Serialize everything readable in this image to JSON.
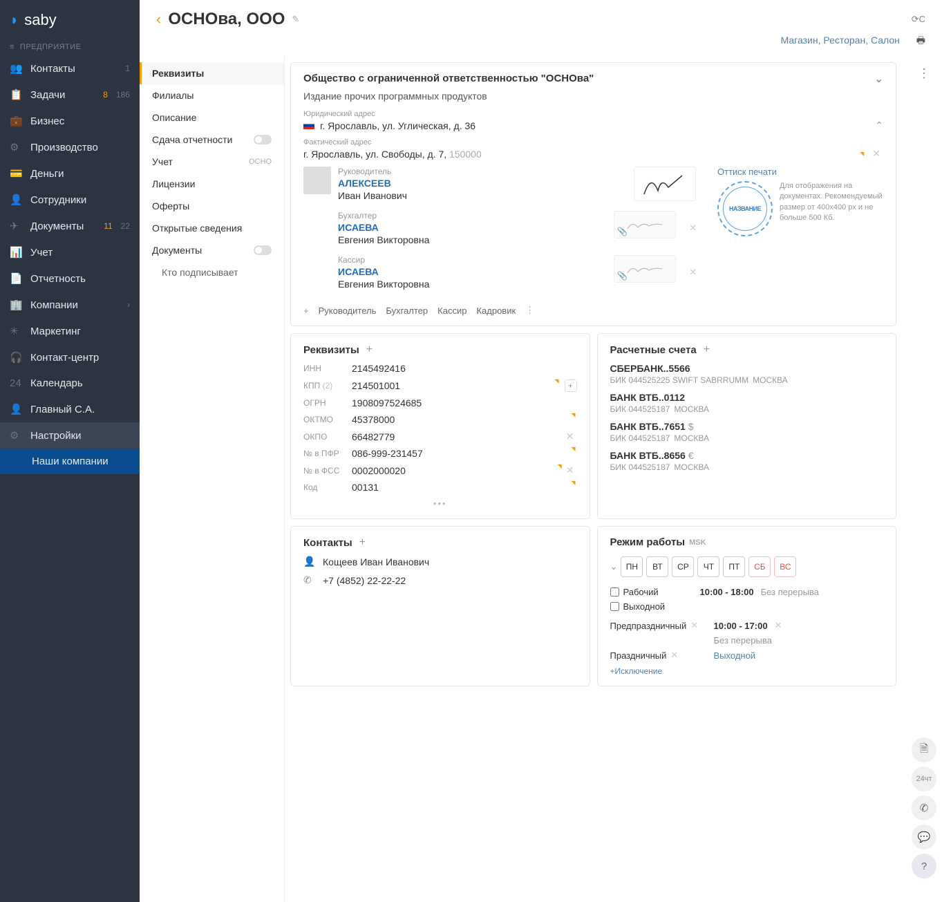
{
  "logo": "saby",
  "nav_section": "ПРЕДПРИЯТИЕ",
  "nav": [
    {
      "icon": "👥",
      "label": "Контакты",
      "b2": "1"
    },
    {
      "icon": "📋",
      "label": "Задачи",
      "b1": "8",
      "b2": "186"
    },
    {
      "icon": "💼",
      "label": "Бизнес"
    },
    {
      "icon": "⚙",
      "label": "Производство"
    },
    {
      "icon": "💳",
      "label": "Деньги"
    },
    {
      "icon": "👤",
      "label": "Сотрудники"
    },
    {
      "icon": "✈",
      "label": "Документы",
      "b1": "11",
      "b2": "22"
    },
    {
      "icon": "📊",
      "label": "Учет"
    },
    {
      "icon": "📄",
      "label": "Отчетность"
    },
    {
      "icon": "🏢",
      "label": "Компании",
      "arrow": "›"
    },
    {
      "icon": "✳",
      "label": "Маркетинг"
    },
    {
      "icon": "🎧",
      "label": "Контакт-центр"
    },
    {
      "icon": "24",
      "label": "Календарь"
    },
    {
      "icon": "👤",
      "label": "Главный С.А."
    },
    {
      "icon": "⚙",
      "label": "Настройки",
      "active": true
    }
  ],
  "nav_sub": "Наши компании",
  "header": {
    "title": "ОСНОва, ООО",
    "type_link": "Магазин, Ресторан, Салон",
    "sync": "⟳С"
  },
  "tabs": [
    {
      "label": "Реквизиты",
      "active": true
    },
    {
      "label": "Филиалы"
    },
    {
      "label": "Описание"
    },
    {
      "label": "Сдача отчетности",
      "toggle": true
    },
    {
      "label": "Учет",
      "tag": "ОСНО"
    },
    {
      "label": "Лицензии"
    },
    {
      "label": "Оферты"
    },
    {
      "label": "Открытые сведения"
    },
    {
      "label": "Документы",
      "toggle": true
    },
    {
      "label": "Кто подписывает",
      "sub": true
    }
  ],
  "org": {
    "full": "Общество с ограниченной ответственностью \"ОСНОва\"",
    "desc": "Издание прочих программных продуктов",
    "addr_legal_lbl": "Юридический адрес",
    "addr_legal": "г. Ярославль, ул. Углическая, д. 36",
    "addr_fact_lbl": "Фактический адрес",
    "addr_fact": "г. Ярославль, ул. Свободы, д. 7, ",
    "addr_fact_post": "150000"
  },
  "people": [
    {
      "role": "Руководитель",
      "surname": "АЛЕКСЕЕВ",
      "name": "Иван Иванович",
      "avatar": true,
      "big": true
    },
    {
      "role": "Бухгалтер",
      "surname": "ИСАЕВА",
      "name": "Евгения Викторовна",
      "small": true
    },
    {
      "role": "Кассир",
      "surname": "ИСАЕВА",
      "name": "Евгения Викторовна",
      "small": true
    }
  ],
  "stamp": {
    "label": "Оттиск печати",
    "text": "НАЗВАНИЕ",
    "hint": "Для отображения на документах. Рекомендуемый размер от 400x400 px и не больше 500 Кб."
  },
  "add_roles": [
    "Руководитель",
    "Бухгалтер",
    "Кассир",
    "Кадровик"
  ],
  "req": {
    "title": "Реквизиты",
    "rows": [
      {
        "lbl": "ИНН",
        "val": "2145492416"
      },
      {
        "lbl": "КПП",
        "sub": "(2)",
        "val": "214501001",
        "mark": true,
        "add": true
      },
      {
        "lbl": "ОГРН",
        "val": "1908097524685"
      },
      {
        "lbl": "ОКТМО",
        "val": "45378000",
        "mark": true
      },
      {
        "lbl": "ОКПО",
        "val": "66482779",
        "x": true
      },
      {
        "lbl": "№ в ПФР",
        "val": "086-999-231457",
        "mark": true
      },
      {
        "lbl": "№ в ФСС",
        "val": "0002000020",
        "mark": true,
        "x": true
      },
      {
        "lbl": "Код",
        "val": "00131",
        "mark": true
      }
    ]
  },
  "banks": {
    "title": "Расчетные счета",
    "items": [
      {
        "name": "СБЕРБАНК..5566",
        "info": "БИК 044525225 SWIFT SABRRUMM",
        "city": "МОСКВА"
      },
      {
        "name": "БАНК ВТБ..0112",
        "info": "БИК 044525187",
        "city": "МОСКВА"
      },
      {
        "name": "БАНК ВТБ..7651",
        "cur": "$",
        "info": "БИК 044525187",
        "city": "МОСКВА"
      },
      {
        "name": "БАНК ВТБ..8656",
        "cur": "€",
        "info": "БИК 044525187",
        "city": "МОСКВА"
      }
    ]
  },
  "contacts": {
    "title": "Контакты",
    "person": "Кощеев Иван Иванович",
    "phone": "+7 (4852) 22-22-22"
  },
  "hours": {
    "title": "Режим работы",
    "tz": "MSK",
    "days": [
      "ПН",
      "ВТ",
      "СР",
      "ЧТ",
      "ПТ",
      "СБ",
      "ВС"
    ],
    "work_lbl": "Рабочий",
    "work_time": "10:00 - 18:00",
    "work_note": "Без перерыва",
    "off_lbl": "Выходной",
    "pre_lbl": "Предпраздничный",
    "pre_time": "10:00 - 17:00",
    "pre_note": "Без перерыва",
    "hol_lbl": "Праздничный",
    "hol_val": "Выходной",
    "add": "+Исключение"
  },
  "side": {
    "day": "24",
    "wd": "чт"
  }
}
